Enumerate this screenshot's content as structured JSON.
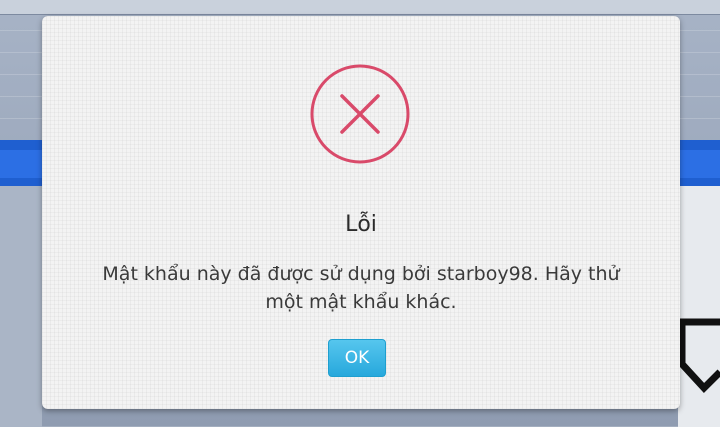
{
  "dialog": {
    "icon": "error-x-circle-icon",
    "title": "Lỗi",
    "message": "Mật khẩu này đã được sử dụng bởi starboy98. Hãy thử một mật khẩu khác.",
    "ok_label": "OK"
  },
  "colors": {
    "error_accent": "#d94a6a",
    "button_bg": "#2fb0e2",
    "dialog_bg": "#f3f3f3",
    "background_blue_bar": "#1f5fd0"
  }
}
